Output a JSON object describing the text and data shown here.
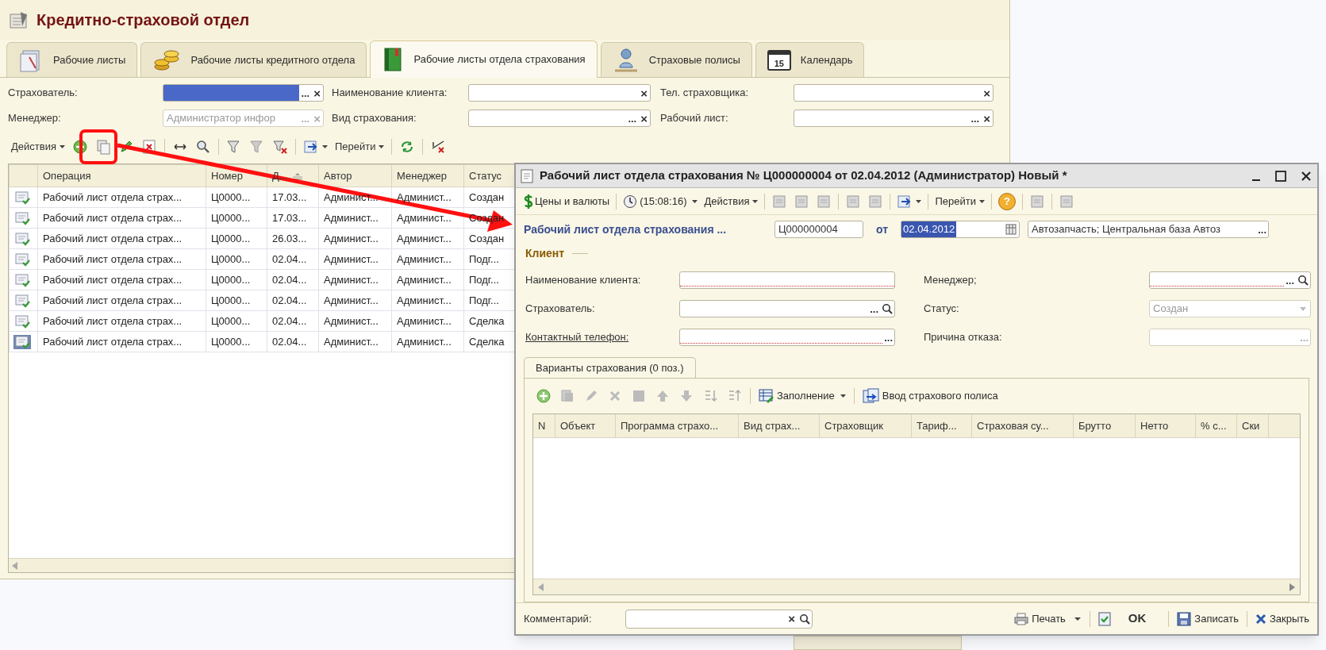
{
  "window": {
    "title": "Кредитно-страховой отдел"
  },
  "tabs": [
    {
      "label": "Рабочие листы",
      "selected": false
    },
    {
      "label": "Рабочие листы кредитного отдела",
      "selected": false
    },
    {
      "label": "Рабочие листы отдела страхования",
      "selected": true
    },
    {
      "label": "Страховые полисы",
      "selected": false
    },
    {
      "label": "Календарь",
      "selected": false,
      "icon_text": "15"
    }
  ],
  "filters": [
    {
      "label": "Страхователь:",
      "highlighted": true,
      "disabled": false,
      "buttons": [
        {
          "kind": "select",
          "text": "..."
        },
        {
          "kind": "clear",
          "text": "×"
        }
      ]
    },
    {
      "label": "Наименование клиента:",
      "highlighted": false,
      "disabled": false,
      "buttons": [
        {
          "kind": "clear",
          "text": "×"
        }
      ]
    },
    {
      "label": "Тел. страховщика:",
      "highlighted": false,
      "disabled": false,
      "buttons": [
        {
          "kind": "clear",
          "text": "×"
        }
      ]
    },
    {
      "label": "Менеджер:",
      "value": "Администратор инфор",
      "highlighted": false,
      "disabled": true,
      "buttons": [
        {
          "kind": "select",
          "text": "..."
        },
        {
          "kind": "clear",
          "text": "×"
        }
      ]
    },
    {
      "label": "Вид страхования:",
      "highlighted": false,
      "disabled": false,
      "buttons": [
        {
          "kind": "select",
          "text": "..."
        },
        {
          "kind": "clear",
          "text": "×"
        }
      ]
    },
    {
      "label": "Рабочий лист:",
      "highlighted": false,
      "disabled": false,
      "buttons": [
        {
          "kind": "select",
          "text": "..."
        },
        {
          "kind": "clear",
          "text": "×"
        }
      ]
    }
  ],
  "toolbar": {
    "actions": "Действия",
    "goto": "Перейти"
  },
  "annotation": {
    "highlight_frame": true,
    "arrow": true
  },
  "table": {
    "columns": [
      {
        "label": "Операция",
        "sorted": false
      },
      {
        "label": "Номер",
        "sorted": false
      },
      {
        "label": "Д...",
        "sorted": true
      },
      {
        "label": "Автор",
        "sorted": false
      },
      {
        "label": "Менеджер",
        "sorted": false
      },
      {
        "label": "Статус",
        "sorted": false
      }
    ],
    "rows": [
      {
        "cells": [
          "Рабочий лист отдела страх...",
          "Ц0000...",
          "17.03...",
          "Админист...",
          "Админист...",
          "Создан"
        ],
        "selected": false
      },
      {
        "cells": [
          "Рабочий лист отдела страх...",
          "Ц0000...",
          "17.03...",
          "Админист...",
          "Админист...",
          "Создан"
        ],
        "selected": false
      },
      {
        "cells": [
          "Рабочий лист отдела страх...",
          "Ц0000...",
          "26.03...",
          "Админист...",
          "Админист...",
          "Создан"
        ],
        "selected": false
      },
      {
        "cells": [
          "Рабочий лист отдела страх...",
          "Ц0000...",
          "02.04...",
          "Админист...",
          "Админист...",
          "Подг..."
        ],
        "selected": false
      },
      {
        "cells": [
          "Рабочий лист отдела страх...",
          "Ц0000...",
          "02.04...",
          "Админист...",
          "Админист...",
          "Подг..."
        ],
        "selected": false
      },
      {
        "cells": [
          "Рабочий лист отдела страх...",
          "Ц0000...",
          "02.04...",
          "Админист...",
          "Админист...",
          "Подг..."
        ],
        "selected": false
      },
      {
        "cells": [
          "Рабочий лист отдела страх...",
          "Ц0000...",
          "02.04...",
          "Админист...",
          "Админист...",
          "Сделка"
        ],
        "selected": false
      },
      {
        "cells": [
          "Рабочий лист отдела страх...",
          "Ц0000...",
          "02.04...",
          "Админист...",
          "Админист...",
          "Сделка"
        ],
        "selected": true
      }
    ]
  },
  "dialog": {
    "title": "Рабочий лист отдела страхования № Ц000000004 от 02.04.2012 (Администратор) Новый *",
    "toolbar": {
      "prices": "Цены и валюты",
      "time": "(15:08:16)",
      "actions": "Действия",
      "goto": "Перейти",
      "help": "?"
    },
    "header": {
      "label": "Рабочий лист отдела страхования ...",
      "number": "Ц000000004",
      "date_prefix": "от",
      "date": "02.04.2012",
      "date_selected": true,
      "organization": "Автозапчасть; Центральная база Автоз",
      "organization_button": "..."
    },
    "group": "Клиент",
    "fields": [
      {
        "label": "Наименование клиента:",
        "link": false,
        "required": true,
        "disabled": false
      },
      {
        "label": "Менеджер;",
        "link": false,
        "required": true,
        "disabled": false,
        "buttons": [
          {
            "kind": "select",
            "text": "..."
          },
          {
            "kind": "search"
          }
        ]
      },
      {
        "label": "Страхователь:",
        "link": false,
        "required": false,
        "disabled": false,
        "buttons": [
          {
            "kind": "select",
            "text": "..."
          },
          {
            "kind": "search"
          }
        ]
      },
      {
        "label": "Статус:",
        "value": "Создан",
        "link": false,
        "required": false,
        "disabled": true,
        "buttons": [
          {
            "kind": "dropdown"
          }
        ]
      },
      {
        "label": "Контактный телефон:",
        "link": true,
        "required": true,
        "disabled": false,
        "buttons": [
          {
            "kind": "select",
            "text": "..."
          }
        ]
      },
      {
        "label": "Причина отказа:",
        "link": false,
        "required": false,
        "disabled": true,
        "buttons": [
          {
            "kind": "select",
            "text": "..."
          }
        ]
      }
    ],
    "tab": {
      "label": "Варианты страхования (0 поз.)",
      "selected": true
    },
    "subtoolbar": {
      "fill": "Заполнение",
      "policy": "Ввод страхового полиса"
    },
    "columns": [
      "N",
      "Объект",
      "Программа страхо...",
      "Вид страх...",
      "Страховщик",
      "Тариф...",
      "Страховая су...",
      "Брутто",
      "Нетто",
      "% с...",
      "Ски"
    ],
    "footer": {
      "comment_label": "Комментарий:",
      "comment_buttons": [
        {
          "kind": "clear",
          "text": "×"
        },
        {
          "kind": "search"
        }
      ],
      "print": "Печать",
      "ok": "OK",
      "save": "Записать",
      "close": "Закрыть"
    }
  }
}
